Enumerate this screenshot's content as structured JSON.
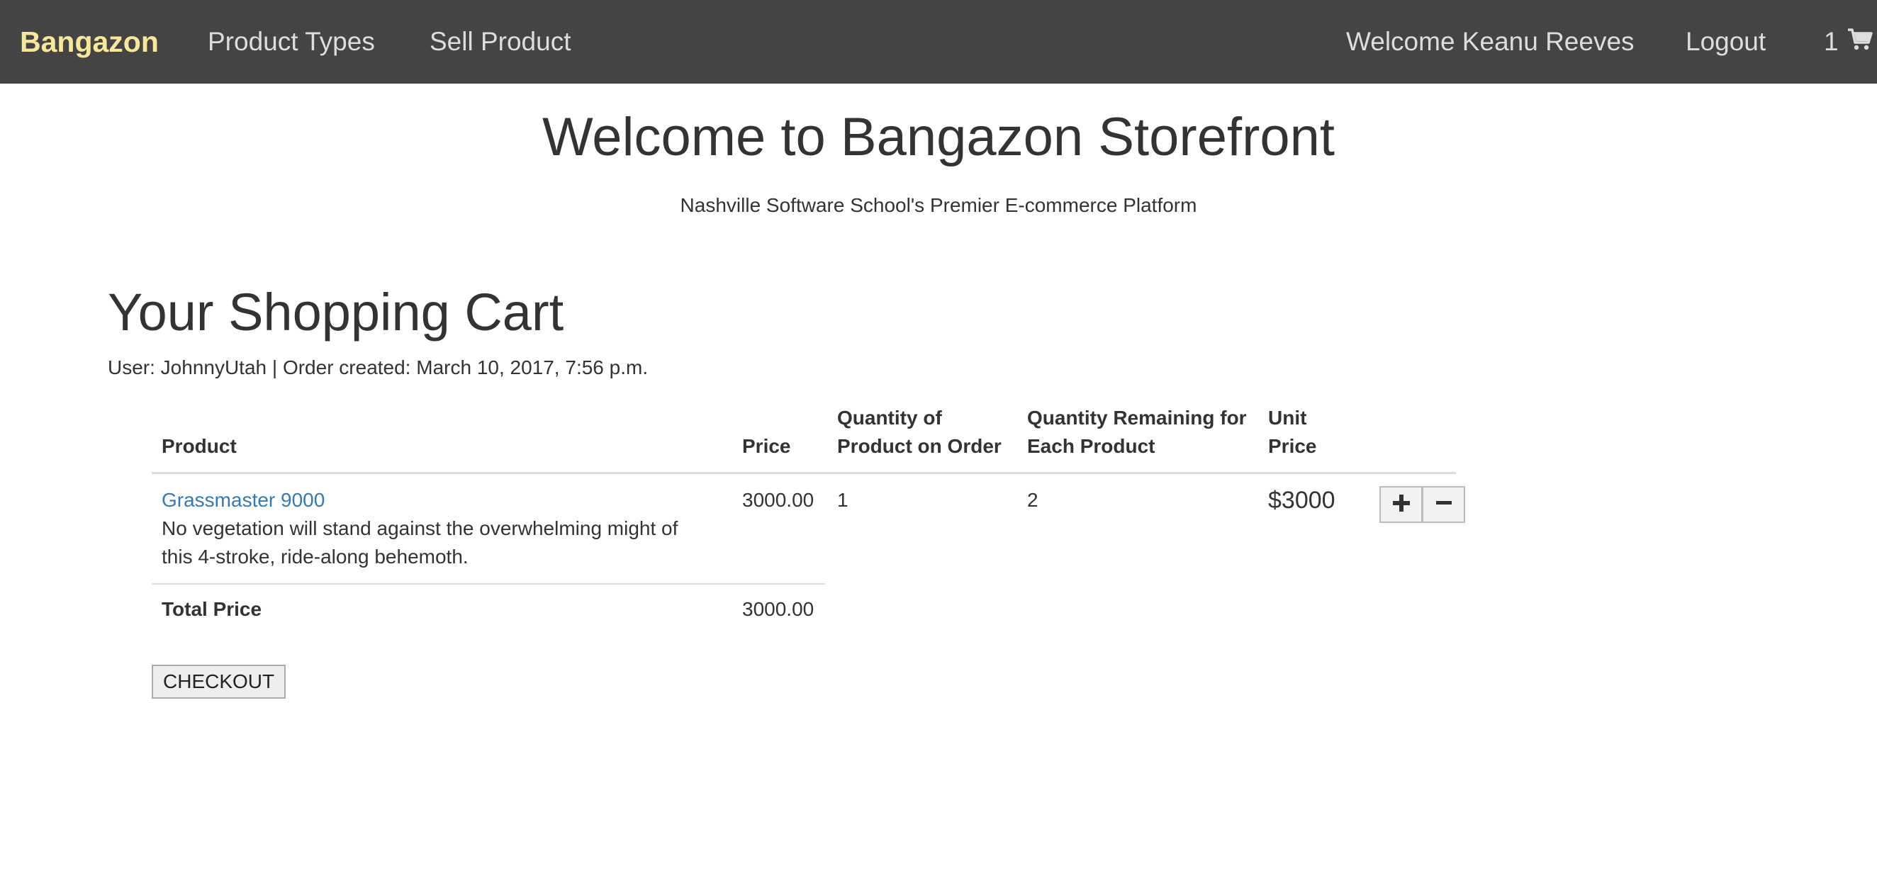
{
  "navbar": {
    "brand": "Bangazon",
    "product_types": "Product Types",
    "sell_product": "Sell Product",
    "welcome": "Welcome Keanu Reeves",
    "logout": "Logout",
    "cart_count": "1",
    "cart_icon": "shopping-cart-icon",
    "background": "#444444",
    "brand_color": "#f7e79a"
  },
  "header": {
    "title": "Welcome to Bangazon Storefront",
    "subtitle": "Nashville Software School's Premier E-commerce Platform"
  },
  "cart": {
    "heading": "Your Shopping Cart",
    "meta": "User: JohnnyUtah | Order created: March 10, 2017, 7:56 p.m.",
    "columns": {
      "product": "Product",
      "price": "Price",
      "qty_on_order": [
        "Quantity of",
        "Product on Order"
      ],
      "qty_remaining": [
        "Quantity Remaining for",
        "Each Product"
      ],
      "unit_price": [
        "Unit",
        "Price"
      ]
    },
    "items": [
      {
        "name": "Grassmaster 9000",
        "description_lines": [
          "No vegetation will stand against the overwhelming might of",
          "this 4-stroke, ride-along behemoth."
        ],
        "price": "3000.00",
        "qty_on_order": "1",
        "qty_remaining": "2",
        "unit_price": "$3000"
      }
    ],
    "total_label": "Total Price",
    "total_value": "3000.00",
    "checkout_label": "CHECKOUT",
    "link_color": "#337ab7"
  }
}
